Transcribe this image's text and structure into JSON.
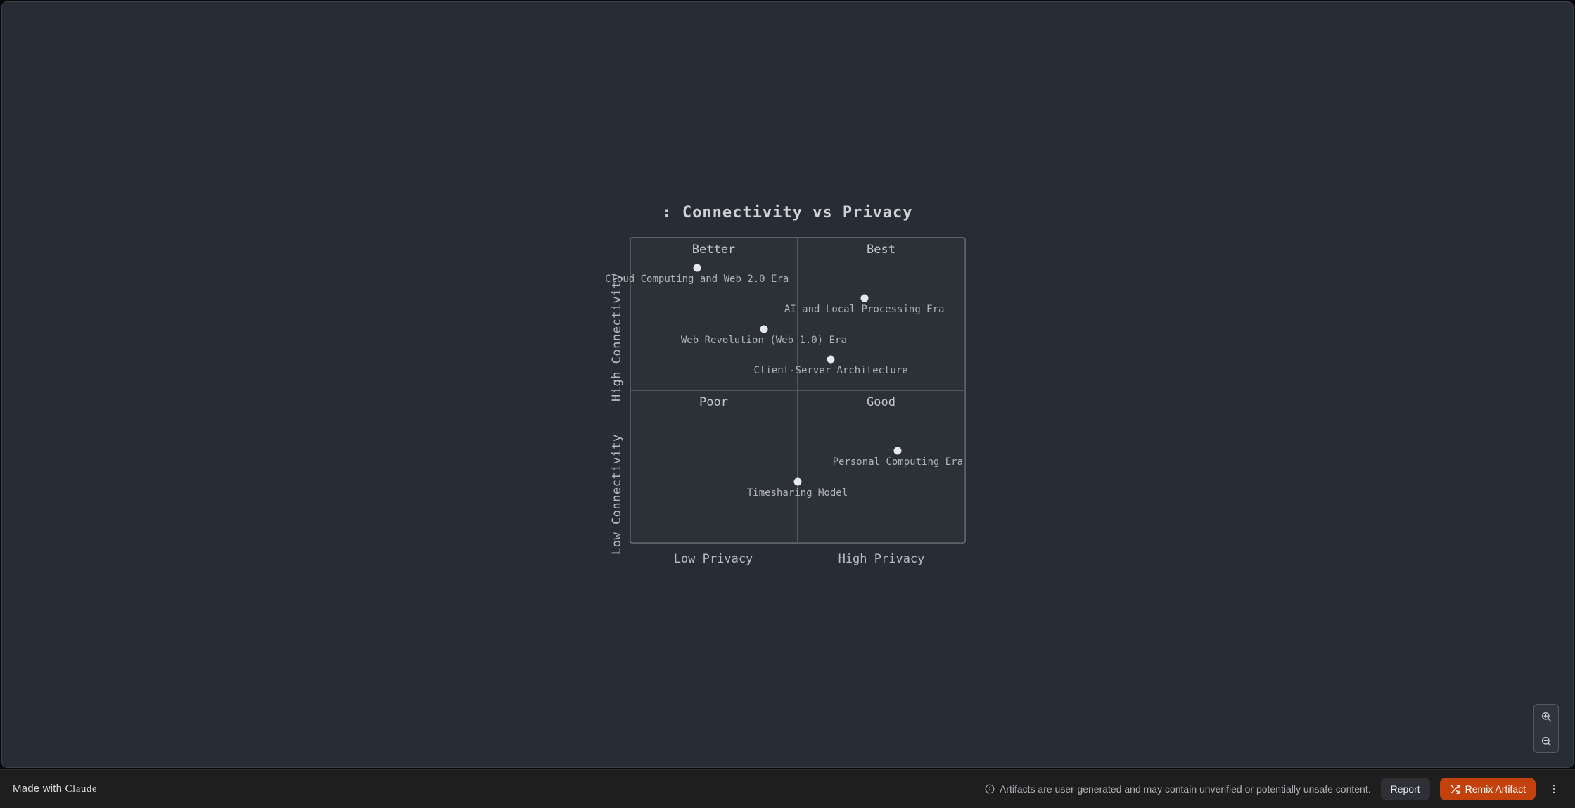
{
  "chart_data": {
    "type": "scatter",
    "title": ": Connectivity vs Privacy",
    "xlabel_low": "Low Privacy",
    "xlabel_high": "High Privacy",
    "ylabel_high": "High Connectivity",
    "ylabel_low": "Low Connectivity",
    "xlim": [
      0,
      1
    ],
    "ylim": [
      0,
      1
    ],
    "quadrants": {
      "top_left": "Better",
      "top_right": "Best",
      "bottom_left": "Poor",
      "bottom_right": "Good"
    },
    "series": [
      {
        "name": "Cloud Computing and Web 2.0 Era",
        "x": 0.2,
        "y": 0.9
      },
      {
        "name": "AI and Local Processing Era",
        "x": 0.7,
        "y": 0.8
      },
      {
        "name": "Web Revolution (Web 1.0) Era",
        "x": 0.4,
        "y": 0.7
      },
      {
        "name": "Client-Server Architecture",
        "x": 0.6,
        "y": 0.6
      },
      {
        "name": "Personal Computing Era",
        "x": 0.8,
        "y": 0.3
      },
      {
        "name": "Timesharing Model",
        "x": 0.5,
        "y": 0.2
      }
    ]
  },
  "footer": {
    "made_with_prefix": "Made with ",
    "made_with_brand": "Claude",
    "notice": "Artifacts are user-generated and may contain unverified or potentially unsafe content.",
    "report_label": "Report",
    "remix_label": "Remix Artifact"
  }
}
